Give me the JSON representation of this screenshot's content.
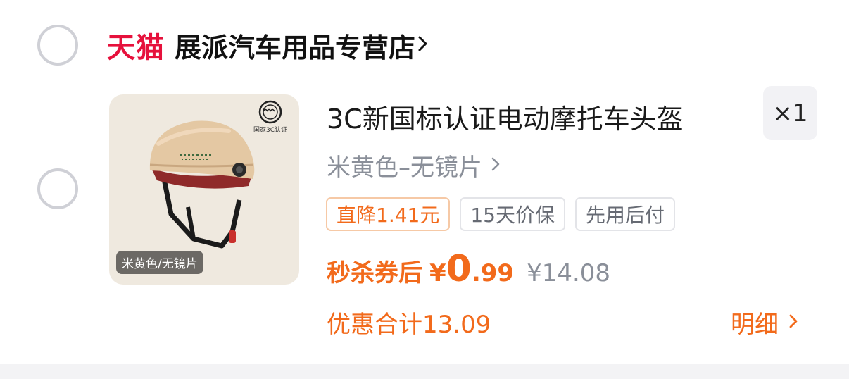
{
  "store": {
    "platform_label": "天猫",
    "name": "展派汽车用品专营店"
  },
  "item": {
    "title": "3C新国标认证电动摩托车头盔",
    "quantity": "×1",
    "spec": "米黄色–无镜片",
    "image_label": "米黄色/无镜片",
    "image_cert_text": "国家3C认证",
    "tags": [
      "直降1.41元",
      "15天价保",
      "先用后付"
    ],
    "price_label": "秒杀券后",
    "currency": "¥",
    "price_int": "0",
    "price_dec": ".99",
    "original_price": "¥14.08",
    "discount_total": "优惠合计13.09",
    "detail_link": "明细"
  },
  "colors": {
    "accent": "#f26a1b",
    "brand": "#e6113c"
  }
}
